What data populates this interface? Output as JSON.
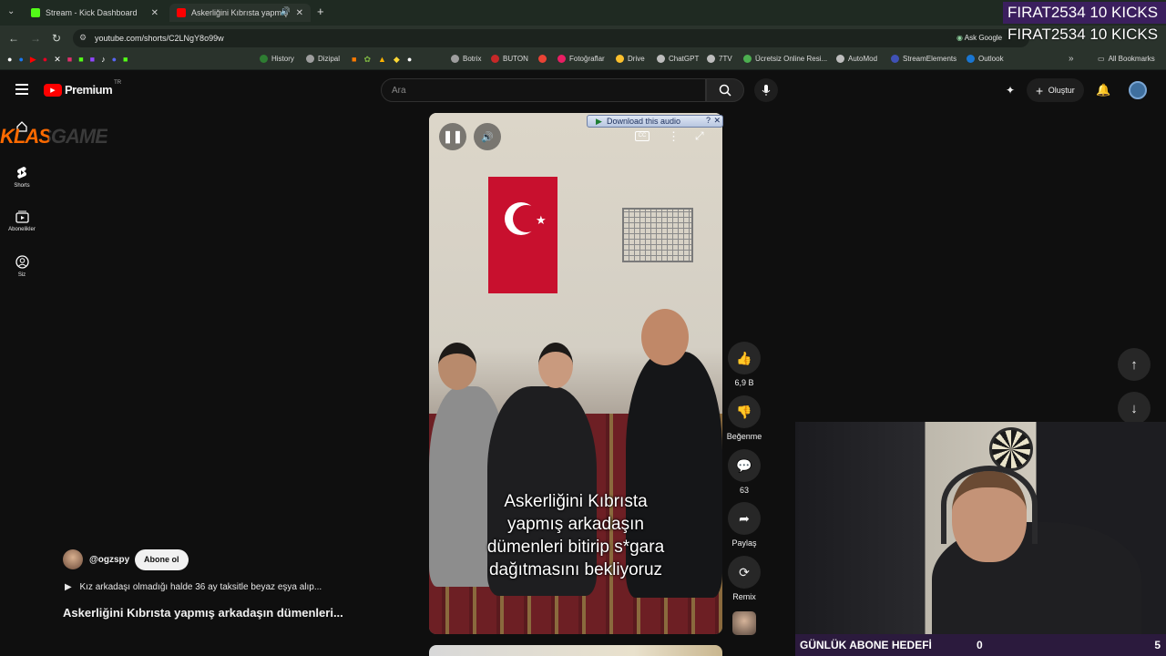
{
  "browser": {
    "tabs": [
      {
        "title": "Stream - Kick Dashboard",
        "favicon_color": "#53fc18"
      },
      {
        "title": "Askerliğini Kıbrısta yapmış",
        "favicon_color": "#ff0000"
      }
    ],
    "url": "youtube.com/shorts/C2LNgY8o99w",
    "ask_google": "Ask Google",
    "bookmarks": [
      {
        "label": "History",
        "color": "#2e7d32"
      },
      {
        "label": "Dizipal",
        "color": "#9e9e9e"
      },
      {
        "label": "Botrix",
        "color": "#9e9e9e"
      },
      {
        "label": "BUTON",
        "color": "#c62828"
      },
      {
        "label": "Fotoğraflar",
        "color": "#e91e63"
      },
      {
        "label": "Drive",
        "color": "#fbc02d"
      },
      {
        "label": "ChatGPT",
        "color": "#bdbdbd"
      },
      {
        "label": "7TV",
        "color": "#bdbdbd"
      },
      {
        "label": "Ücretsiz Online Resi...",
        "color": "#4caf50"
      },
      {
        "label": "AutoMod",
        "color": "#bdbdbd"
      },
      {
        "label": "StreamElements",
        "color": "#3f51b5"
      },
      {
        "label": "Outlook",
        "color": "#1976d2"
      }
    ],
    "all_bookmarks": "All Bookmarks"
  },
  "youtube": {
    "logo": "Premium",
    "region": "TR",
    "search_placeholder": "Ara",
    "create_label": "Oluştur",
    "sidebar": [
      {
        "label": "Shorts",
        "icon": "shorts-icon"
      },
      {
        "label": "Abonelikler",
        "icon": "subscriptions-icon"
      },
      {
        "label": "Siz",
        "icon": "you-icon"
      }
    ],
    "short": {
      "caption": [
        "Askerliğini Kıbrısta",
        "yapmış arkadaşın",
        "dümenleri bitirip s*gara",
        "dağıtmasını bekliyoruz"
      ],
      "download_label": "Download this audio",
      "channel": "@ogzspy",
      "subscribe": "Abone ol",
      "music_line": "Kız arkadaşı olmadığı halde 36 ay taksitle beyaz eşya alıp...",
      "title": "Askerliğini Kıbrısta yapmış arkadaşın dümenleri..."
    },
    "actions": {
      "likes": "6,9 B",
      "dislike": "Beğenme",
      "comments": "63",
      "share": "Paylaş",
      "remix": "Remix"
    }
  },
  "stream_overlay": {
    "kicks_line": "FIRAT2534  10 KICKS",
    "kicks_line_shadow": "FIRAT2534  10 KICKS",
    "klas_logo": "KLASGAME",
    "goal_label": "GÜNLÜK ABONE HEDEFİ",
    "goal_current": "0",
    "goal_target": "5"
  }
}
